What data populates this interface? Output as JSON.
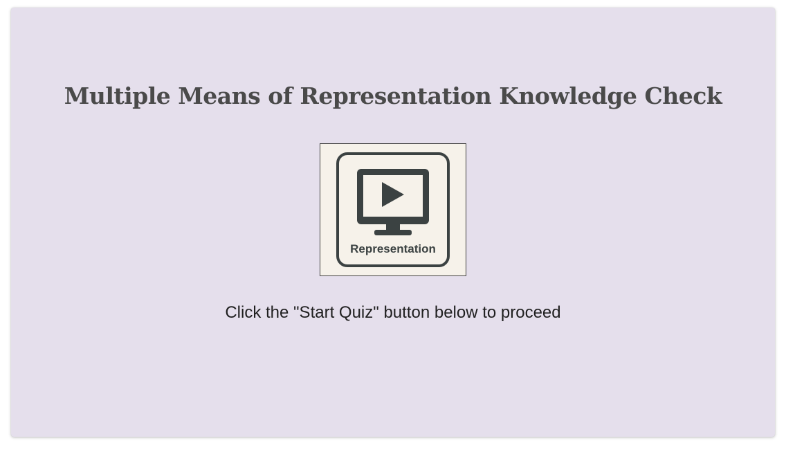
{
  "slide": {
    "title": "Multiple Means of Representation Knowledge Check",
    "image": {
      "icon": "monitor-play-icon",
      "label": "Representation"
    },
    "instruction": "Click the \"Start Quiz\" button below to proceed"
  },
  "colors": {
    "card_background": "#e5dfec",
    "title_text": "#4a4a4a",
    "icon_dark": "#3b4242",
    "icon_background": "#f6f2ea"
  }
}
